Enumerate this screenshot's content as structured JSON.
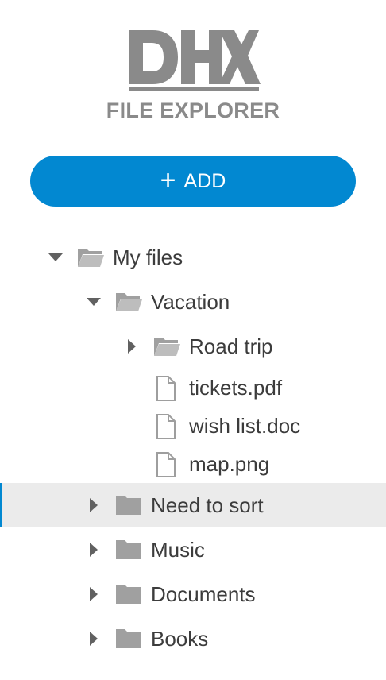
{
  "header": {
    "logo_text": "DHX",
    "subtitle": "FILE EXPLORER"
  },
  "actions": {
    "add_label": "ADD"
  },
  "tree": {
    "my_files": "My files",
    "vacation": "Vacation",
    "road_trip": "Road trip",
    "tickets": "tickets.pdf",
    "wish_list": "wish list.doc",
    "map": "map.png",
    "need_to_sort": "Need to sort",
    "music": "Music",
    "documents": "Documents",
    "books": "Books"
  },
  "colors": {
    "accent": "#0288d1",
    "selected_row": "#ebebeb",
    "icon_gray": "#a0a0a0",
    "text": "#3c3c3c"
  }
}
